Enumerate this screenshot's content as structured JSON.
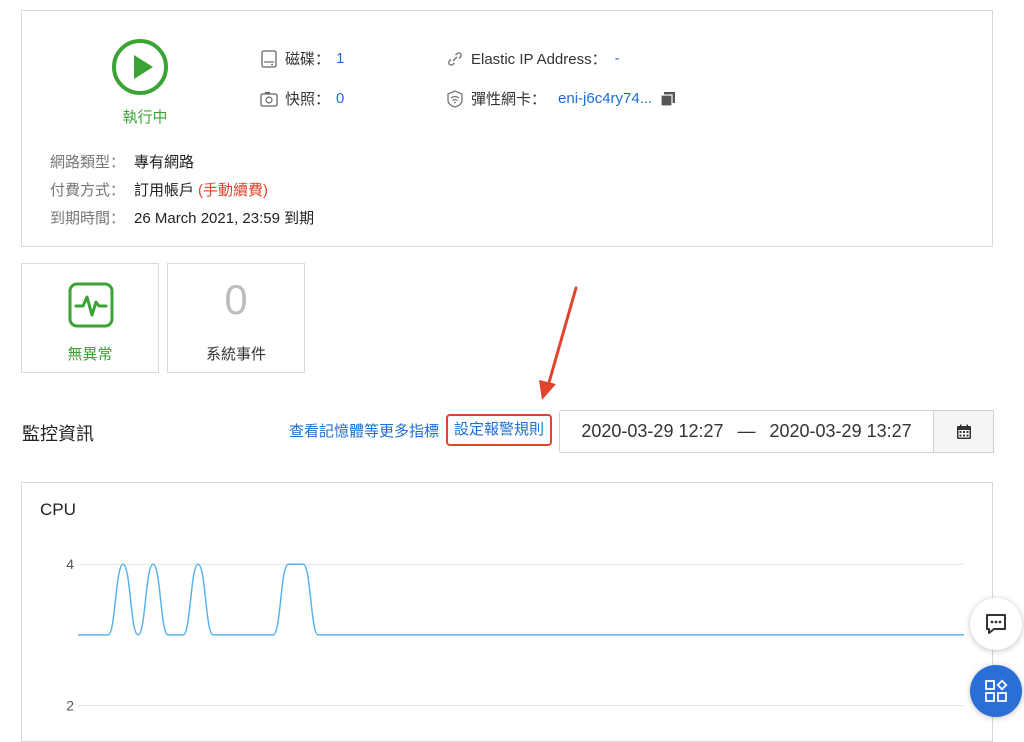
{
  "instance": {
    "status_label": "執行中",
    "disk_label": "磁碟：",
    "disk_count": "1",
    "snapshot_label": "快照：",
    "snapshot_count": "0",
    "eip_label": "Elastic IP Address：",
    "eip_value": "-",
    "eni_label": "彈性網卡：",
    "eni_value": "eni-j6c4ry74...",
    "network_type_label": "網路類型：",
    "network_type_value": "專有網路",
    "billing_label": "付費方式：",
    "billing_value": "訂用帳戶",
    "billing_note": "(手動續費)",
    "expiry_label": "到期時間：",
    "expiry_value": "26 March 2021, 23:59 到期"
  },
  "health": {
    "label": "無異常"
  },
  "events": {
    "count": "0",
    "label": "系統事件"
  },
  "monitor": {
    "title": "監控資訊",
    "more_metrics_link": "查看記憶體等更多指標",
    "set_alarm_link": "設定報警規則",
    "date_start": "2020-03-29 12:27",
    "date_sep": "—",
    "date_end": "2020-03-29 13:27"
  },
  "colors": {
    "accent": "#1a6fd1",
    "success": "#3aa334",
    "alert": "#e0442c",
    "line": "#5ab4ea"
  },
  "icons": [
    "play-circle-icon",
    "disk-icon",
    "snapshot-icon",
    "link-icon",
    "eni-icon",
    "copy-icon",
    "heartbeat-icon",
    "calendar-icon",
    "chat-icon",
    "apps-icon"
  ],
  "chart_data": {
    "type": "line",
    "title": "CPU",
    "yticks": [
      2,
      4
    ],
    "ylim": [
      1.5,
      4.3
    ],
    "x": [
      0,
      1,
      2,
      3,
      4,
      5,
      6,
      7,
      8,
      9,
      10,
      11,
      12,
      13,
      14,
      15,
      16,
      17,
      18,
      19,
      20,
      21,
      22,
      23,
      24,
      25,
      26,
      27,
      28,
      29,
      30,
      31,
      32,
      33,
      34,
      35,
      36,
      37,
      38,
      39,
      40,
      41,
      42,
      43,
      44,
      45,
      46,
      47,
      48,
      49,
      50,
      51,
      52,
      53,
      54,
      55,
      56,
      57,
      58,
      59
    ],
    "series": [
      {
        "values": [
          3,
          3,
          3,
          4,
          3,
          4,
          3,
          3,
          4,
          3,
          3,
          3,
          3,
          3,
          4,
          4,
          3,
          3,
          3,
          3,
          3,
          3,
          3,
          3,
          3,
          3,
          3,
          3,
          3,
          3,
          3,
          3,
          3,
          3,
          3,
          3,
          3,
          3,
          3,
          3,
          3,
          3,
          3,
          3,
          3,
          3,
          3,
          3,
          3,
          3,
          3,
          3,
          3,
          3,
          3,
          3,
          3,
          3,
          3,
          3
        ]
      }
    ]
  }
}
